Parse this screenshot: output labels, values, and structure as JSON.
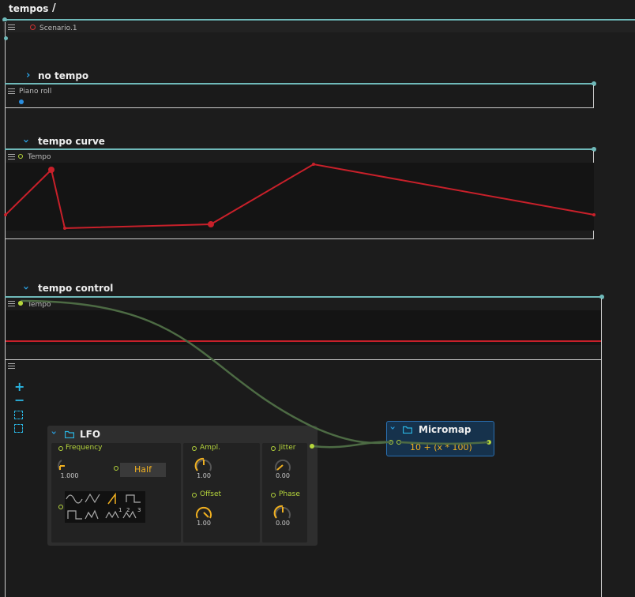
{
  "header": {
    "title": "tempos",
    "separator": "/"
  },
  "scenario": {
    "label": "Scenario.1"
  },
  "sections": {
    "no_tempo": {
      "label": "no tempo",
      "slot_label": "Piano roll"
    },
    "tempo_curve": {
      "label": "tempo curve",
      "slot_label": "Tempo"
    },
    "tempo_control": {
      "label": "tempo control",
      "slot_label": "Tempo"
    }
  },
  "nodal": {
    "zoom_in": "+",
    "zoom_out": "−"
  },
  "lfo": {
    "title": "LFO",
    "frequency": {
      "label": "Frequency",
      "value": "1.000"
    },
    "quantize": {
      "value": "Half"
    },
    "amplitude": {
      "label": "Ampl.",
      "value": "1.00"
    },
    "offset": {
      "label": "Offset",
      "value": "1.00"
    },
    "jitter": {
      "label": "Jitter",
      "value": "0.00"
    },
    "phase": {
      "label": "Phase",
      "value": "0.00"
    },
    "wave_indices": [
      "1",
      "2",
      "3"
    ]
  },
  "micromap": {
    "title": "Micromap",
    "expression": "10 + (x * 100)"
  },
  "colors": {
    "accent": "#6fb9b9",
    "curve": "#c8202a",
    "port": "#b6d63c",
    "cable": "#4d6b44",
    "chevron": "#2a9fe0"
  }
}
